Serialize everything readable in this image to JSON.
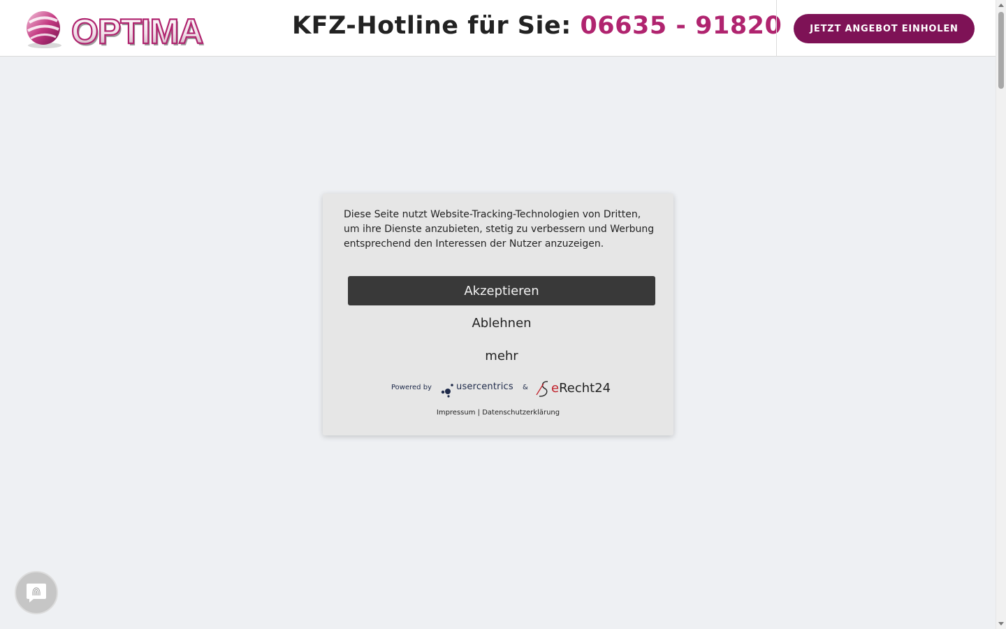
{
  "header": {
    "logo_text": "OPTIMA",
    "hotline_label": "KFZ-Hotline für Sie:",
    "hotline_phone": "06635 - 91820",
    "cta_label": "JETZT ANGEBOT EINHOLEN"
  },
  "cookie_banner": {
    "message": "Diese Seite nutzt Website-Tracking-Technologien von Dritten, um ihre Dienste anzubieten, stetig zu verbessern und Werbung entsprechend den Interessen der Nutzer anzuzeigen.",
    "accept_label": "Akzeptieren",
    "decline_label": "Ablehnen",
    "more_label": "mehr",
    "powered_by": "Powered by",
    "provider_1": "usercentrics",
    "ampersand": "&",
    "provider_2_prefix": "e",
    "provider_2_rest": "Recht24",
    "imprint_link": "Impressum",
    "separator": "|",
    "privacy_link": "Datenschutzerklärung"
  },
  "privacy_button": {
    "icon": "fingerprint-icon"
  },
  "colors": {
    "brand_pink": "#b0246f",
    "cta_bg": "#7e1256",
    "accept_bg": "#393939",
    "page_bg": "#eef0f3"
  }
}
